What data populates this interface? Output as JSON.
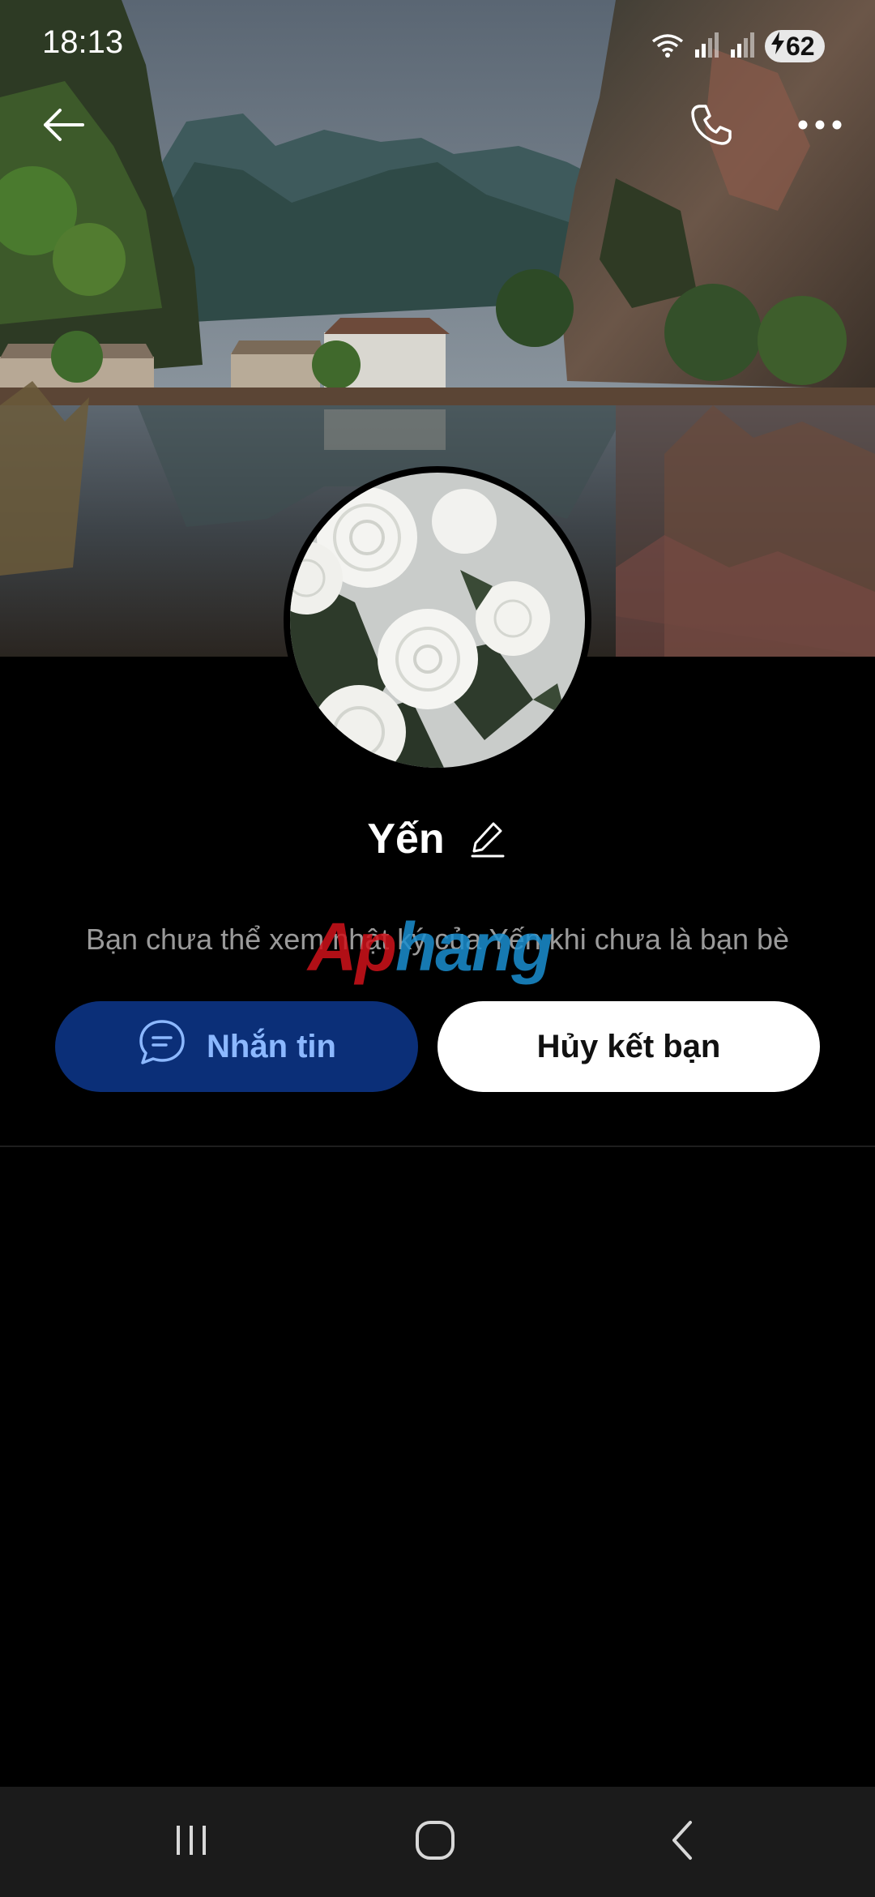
{
  "status_bar": {
    "time": "18:13",
    "battery": "62",
    "icons": [
      "wifi-icon",
      "signal-icon",
      "signal-icon",
      "charging-icon"
    ]
  },
  "nav": {
    "icons": [
      "back-arrow-icon",
      "phone-icon",
      "more-icon"
    ]
  },
  "profile": {
    "name": "Yến",
    "info_text": "Bạn chưa thể xem nhật ký của Yến khi chưa là bạn bè"
  },
  "watermark": {
    "part1": "Ap",
    "part2": "hang",
    "color1": "#d0121b",
    "color2": "#1a8fd0"
  },
  "actions": {
    "message_label": "Nhắn tin",
    "unfriend_label": "Hủy kết bạn"
  },
  "colors": {
    "message_bg": "#0b2f78",
    "message_text": "#8cb8ff",
    "background": "#000000"
  },
  "system_nav": {
    "icons": [
      "recent-apps-icon",
      "home-icon",
      "back-icon"
    ]
  }
}
